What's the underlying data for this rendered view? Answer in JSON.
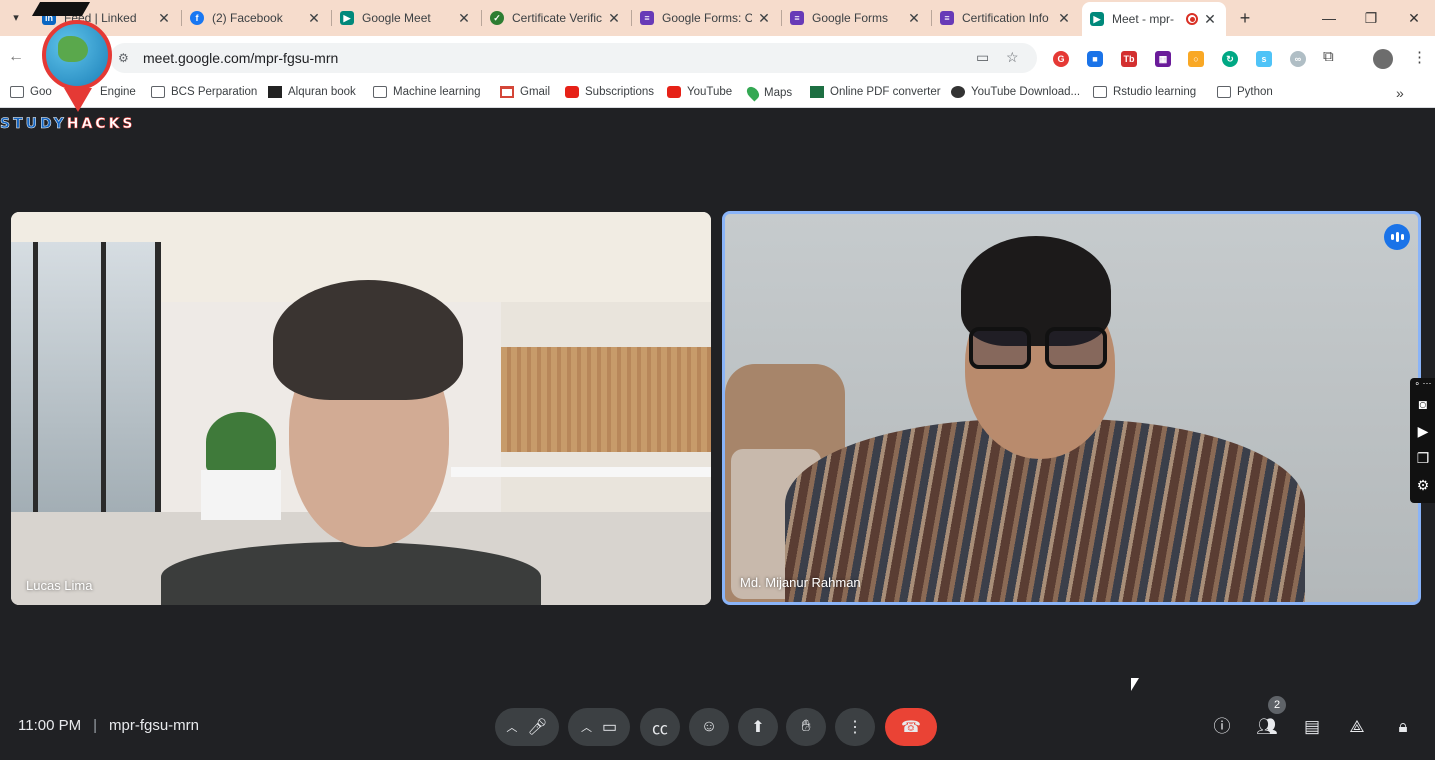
{
  "browser": {
    "tabs": [
      {
        "title": "Feed | Linked",
        "favicon": "linkedin-icon",
        "color": "#0a66c2"
      },
      {
        "title": "(2) Facebook",
        "favicon": "facebook-icon",
        "color": "#1877f2"
      },
      {
        "title": "Google Meet",
        "favicon": "meet-icon",
        "color": "#00897b"
      },
      {
        "title": "Certificate Verific",
        "favicon": "certificate-icon",
        "color": "#2e7d32"
      },
      {
        "title": "Google Forms: O",
        "favicon": "forms-icon",
        "color": "#673ab7"
      },
      {
        "title": "Google Forms",
        "favicon": "forms-icon",
        "color": "#673ab7"
      },
      {
        "title": "Certification Info",
        "favicon": "forms-icon",
        "color": "#673ab7"
      },
      {
        "title": "Meet - mpr-",
        "favicon": "meet-icon",
        "color": "#00897b",
        "active": true
      }
    ],
    "address": "meet.google.com/mpr-fgsu-mrn",
    "bookmarks": [
      {
        "label": "Goo",
        "icon": "folder"
      },
      {
        "label": "Engine",
        "icon": "folder"
      },
      {
        "label": "BCS Perparation",
        "icon": "folder"
      },
      {
        "label": "Alquran book",
        "icon": "black"
      },
      {
        "label": "Machine learning",
        "icon": "folder"
      },
      {
        "label": "Gmail",
        "icon": "gmail"
      },
      {
        "label": "Subscriptions",
        "icon": "yt"
      },
      {
        "label": "YouTube",
        "icon": "yt"
      },
      {
        "label": "Maps",
        "icon": "maps"
      },
      {
        "label": "Online PDF converter",
        "icon": "excel"
      },
      {
        "label": "YouTube Download...",
        "icon": "globe"
      },
      {
        "label": "Rstudio learning",
        "icon": "folder"
      },
      {
        "label": "Python",
        "icon": "folder"
      }
    ]
  },
  "logo": {
    "text_a": "STUDY",
    "text_b": "HACKS"
  },
  "meet": {
    "participants": [
      {
        "name": "Lucas Lima"
      },
      {
        "name": "Md. Mijanur Rahman",
        "speaking": true
      }
    ],
    "time": "11:00 PM",
    "meeting_code": "mpr-fgsu-mrn",
    "people_count": "2"
  },
  "colors": {
    "stage_bg": "#202124",
    "end_call": "#ea4335",
    "active_speaker_border": "#8ab4f8"
  }
}
